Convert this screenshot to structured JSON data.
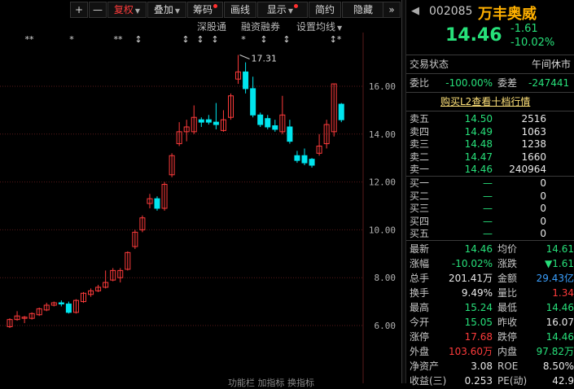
{
  "toolbar": {
    "plus": "+",
    "minus": "—",
    "fuquan": "复权",
    "diejia": "叠加",
    "chouma": "筹码",
    "huaxian": "画线",
    "xianshi": "显示",
    "jianyue": "简约",
    "yincang": "隐藏",
    "more": "»"
  },
  "chart_toolbar": {
    "shengutong": "深股通",
    "rongzi": "融资融券",
    "junxian": "设置均线"
  },
  "chart_footer": "功能栏  加指标  换指标",
  "stock": {
    "code": "002085",
    "name": "万丰奥威",
    "price": "14.46",
    "change": "-1.61",
    "change_pct": "-10.02%"
  },
  "status": {
    "label": "交易状态",
    "value": "午间休市"
  },
  "weibi": {
    "label": "委比",
    "value": "-100.00%",
    "label2": "委差",
    "value2": "-247441"
  },
  "l2_link": "购买L2查看十档行情",
  "sell_orders": [
    {
      "label": "卖五",
      "price": "14.50",
      "vol": "2516"
    },
    {
      "label": "卖四",
      "price": "14.49",
      "vol": "1063"
    },
    {
      "label": "卖三",
      "price": "14.48",
      "vol": "1238"
    },
    {
      "label": "卖二",
      "price": "14.47",
      "vol": "1660"
    },
    {
      "label": "卖一",
      "price": "14.46",
      "vol": "240964"
    }
  ],
  "buy_orders": [
    {
      "label": "买一",
      "price": "—",
      "vol": "0"
    },
    {
      "label": "买二",
      "price": "—",
      "vol": "0"
    },
    {
      "label": "买三",
      "price": "—",
      "vol": "0"
    },
    {
      "label": "买四",
      "price": "—",
      "vol": "0"
    },
    {
      "label": "买五",
      "price": "—",
      "vol": "0"
    }
  ],
  "quote": [
    {
      "l1": "最新",
      "v1": "14.46",
      "c1": "g",
      "l2": "均价",
      "v2": "14.61",
      "c2": "g"
    },
    {
      "l1": "涨幅",
      "v1": "-10.02%",
      "c1": "g",
      "l2": "涨跌",
      "v2": "▼1.61",
      "c2": "g"
    },
    {
      "l1": "总手",
      "v1": "201.41万",
      "c1": "w",
      "l2": "金额",
      "v2": "29.43亿",
      "c2": "b"
    },
    {
      "l1": "换手",
      "v1": "9.49%",
      "c1": "w",
      "l2": "量比",
      "v2": "1.34",
      "c2": "r"
    },
    {
      "l1": "最高",
      "v1": "15.24",
      "c1": "g",
      "l2": "最低",
      "v2": "14.46",
      "c2": "g"
    },
    {
      "l1": "今开",
      "v1": "15.05",
      "c1": "g",
      "l2": "昨收",
      "v2": "16.07",
      "c2": "w"
    },
    {
      "l1": "涨停",
      "v1": "17.68",
      "c1": "r",
      "l2": "跌停",
      "v2": "14.46",
      "c2": "g"
    },
    {
      "l1": "外盘",
      "v1": "103.60万",
      "c1": "r",
      "l2": "内盘",
      "v2": "97.82万",
      "c2": "g"
    },
    {
      "l1": "净资产",
      "v1": "3.08",
      "c1": "w",
      "l2": "ROE",
      "v2": "8.50%",
      "c2": "w"
    },
    {
      "l1": "收益(三)",
      "v1": "0.253",
      "c1": "w",
      "l2": "PE(动)",
      "v2": "42.9",
      "c2": "w"
    }
  ],
  "colors": {
    "up": "#ff3b3b",
    "down": "#00e5ee",
    "grid": "#5a1a1a",
    "bg": "#000000"
  },
  "chart_data": {
    "type": "candlestick",
    "y_ticks": [
      "16.00",
      "14.00",
      "12.00",
      "10.00",
      "8.00",
      "6.00"
    ],
    "ylim": [
      5.0,
      17.8
    ],
    "high_marker": "17.31",
    "top_marks": [
      "**",
      "*",
      "**",
      "↕",
      "↕",
      "↕",
      "↕",
      "*",
      "↕",
      "↕",
      "↕*"
    ],
    "candles": [
      [
        5.95,
        6.25,
        5.9,
        6.3
      ],
      [
        6.25,
        6.4,
        6.2,
        6.6
      ],
      [
        6.3,
        6.35,
        6.1,
        6.4
      ],
      [
        6.3,
        6.5,
        6.25,
        6.55
      ],
      [
        6.45,
        6.7,
        6.4,
        6.75
      ],
      [
        6.65,
        6.85,
        6.6,
        6.95
      ],
      [
        6.85,
        6.95,
        6.8,
        7.0
      ],
      [
        6.95,
        6.9,
        6.8,
        7.05
      ],
      [
        6.9,
        6.55,
        6.5,
        7.0
      ],
      [
        6.55,
        7.05,
        6.5,
        7.1
      ],
      [
        7.0,
        7.35,
        6.95,
        7.4
      ],
      [
        7.3,
        7.45,
        7.2,
        7.55
      ],
      [
        7.45,
        7.6,
        7.4,
        7.7
      ],
      [
        7.6,
        7.8,
        7.55,
        8.3
      ],
      [
        7.9,
        8.3,
        7.85,
        8.4
      ],
      [
        8.0,
        8.3,
        7.8,
        8.4
      ],
      [
        8.35,
        9.05,
        8.3,
        9.1
      ],
      [
        9.3,
        9.9,
        9.2,
        10.0
      ],
      [
        10.0,
        10.5,
        9.9,
        10.6
      ],
      [
        11.1,
        11.3,
        10.9,
        11.5
      ],
      [
        11.3,
        10.9,
        10.8,
        11.4
      ],
      [
        10.9,
        11.9,
        10.8,
        12.0
      ],
      [
        12.3,
        13.1,
        12.2,
        13.2
      ],
      [
        13.6,
        14.1,
        13.5,
        14.5
      ],
      [
        14.1,
        14.3,
        13.7,
        14.6
      ],
      [
        14.1,
        14.7,
        14.0,
        15.2
      ],
      [
        14.6,
        14.5,
        14.3,
        14.7
      ],
      [
        14.6,
        14.5,
        14.4,
        14.8
      ],
      [
        14.5,
        14.4,
        14.2,
        15.3
      ],
      [
        14.15,
        14.6,
        14.1,
        15.0
      ],
      [
        14.7,
        15.6,
        14.6,
        15.7
      ],
      [
        16.3,
        16.6,
        16.1,
        17.31
      ],
      [
        16.6,
        15.9,
        15.7,
        17.0
      ],
      [
        15.9,
        14.8,
        14.7,
        16.4
      ],
      [
        14.8,
        14.4,
        14.3,
        14.9
      ],
      [
        14.65,
        14.3,
        14.2,
        14.8
      ],
      [
        14.35,
        14.2,
        14.1,
        14.6
      ],
      [
        14.1,
        14.8,
        14.0,
        15.6
      ],
      [
        14.3,
        13.7,
        13.6,
        14.6
      ],
      [
        13.1,
        12.9,
        12.8,
        13.3
      ],
      [
        13.1,
        12.8,
        12.7,
        13.4
      ],
      [
        12.95,
        12.7,
        12.6,
        13.0
      ],
      [
        13.2,
        13.5,
        13.1,
        14.0
      ],
      [
        13.6,
        14.4,
        13.4,
        14.6
      ],
      [
        14.1,
        16.1,
        13.9,
        16.1
      ],
      [
        15.25,
        14.6,
        14.5,
        15.3
      ]
    ]
  }
}
